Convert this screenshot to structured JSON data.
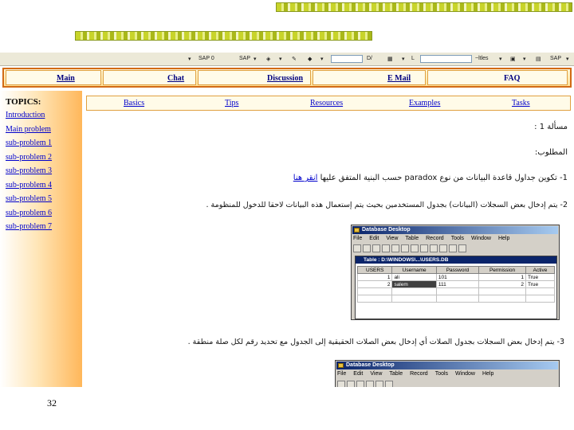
{
  "slide": {
    "page_number": "32"
  },
  "toolbar": {
    "items": [
      "SAP 0",
      "SAP",
      "|",
      "0",
      "D/",
      "L",
      "☆"
    ],
    "right_items": [
      "~ltles",
      "SAP"
    ]
  },
  "nav": {
    "main": "Main",
    "chat": "Chat",
    "discussion": "Discussion",
    "email": "E Mail",
    "faq": "FAQ"
  },
  "sidebar": {
    "heading": "TOPICS:",
    "items": [
      "Introduction",
      "Main problem",
      "sub-problem 1",
      "sub-problem 2",
      "sub-problem 3",
      "sub-problem 4",
      "sub-problem 5",
      "sub-problem 6",
      "sub-problem 7"
    ]
  },
  "subnav": {
    "basics": "Basics",
    "tips": "Tips",
    "resources": "Resources",
    "examples": "Examples",
    "tasks": "Tasks"
  },
  "content": {
    "question": "مسألة 1 :",
    "required": "المطلوب:",
    "step1": "1- تكوين جداول قاعدة البيانات من نوع paradox حسب البنية المتفق عليها",
    "step1_link": "انقر هنا",
    "step2": "2- يتم إدخال بعض السجلات (البيانات) بجدول المستخدمين بحيث يتم إستعمال هذه البيانات لاحقا للدخول للمنظومة .",
    "step3": "3- يتم إدخال بعض السجلات بجدول الصلات أي إدخال بعض الصلات الحقيقية إلى الجدول مع تحديد رقم لكل صلة منطقة ."
  },
  "db1": {
    "title": "Database Desktop",
    "menu": [
      "File",
      "Edit",
      "View",
      "Table",
      "Record",
      "Tools",
      "Window",
      "Help"
    ],
    "table_title": "Table : D:\\WINDOWS\\...\\USERS.DB",
    "columns": [
      "USERS",
      "Username",
      "Password",
      "Permission",
      "Active"
    ],
    "rows": [
      [
        "1",
        "ali",
        "101",
        "1",
        "True"
      ],
      [
        "2",
        "salem",
        "111",
        "2",
        "True"
      ]
    ]
  },
  "db2": {
    "title": "Database Desktop",
    "menu": [
      "File",
      "Edit",
      "View",
      "Table",
      "Record",
      "Tools",
      "Window",
      "Help"
    ]
  }
}
